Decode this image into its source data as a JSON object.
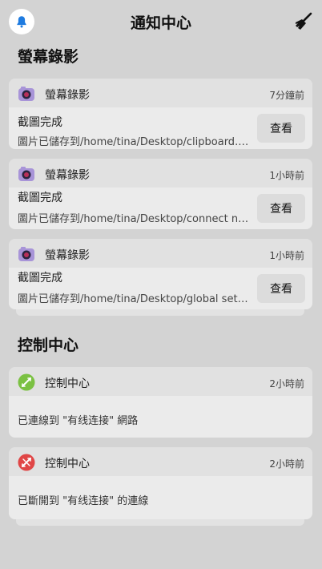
{
  "header": {
    "title": "通知中心",
    "bell_icon": "bell-icon",
    "clear_icon": "broom-icon"
  },
  "sections": [
    {
      "title": "螢幕錄影",
      "notifications": [
        {
          "app": "螢幕錄影",
          "time": "7分鐘前",
          "title": "截圖完成",
          "body": "圖片已儲存到/home/tina/Desktop/clipboard.png",
          "action": "查看"
        },
        {
          "app": "螢幕錄影",
          "time": "1小時前",
          "title": "截圖完成",
          "body": "圖片已儲存到/home/tina/Desktop/connect network.png",
          "action": "查看"
        },
        {
          "app": "螢幕錄影",
          "time": "1小時前",
          "title": "截圖完成",
          "body": "圖片已儲存到/home/tina/Desktop/global settings.png",
          "action": "查看"
        }
      ]
    },
    {
      "title": "控制中心",
      "notifications": [
        {
          "app": "控制中心",
          "time": "2小時前",
          "body": "已連線到 \"有线连接\" 網路",
          "status_color": "#7bc143"
        },
        {
          "app": "控制中心",
          "time": "2小時前",
          "body": "已斷開到 \"有线连接\" 的連線",
          "status_color": "#e04646"
        }
      ]
    }
  ]
}
